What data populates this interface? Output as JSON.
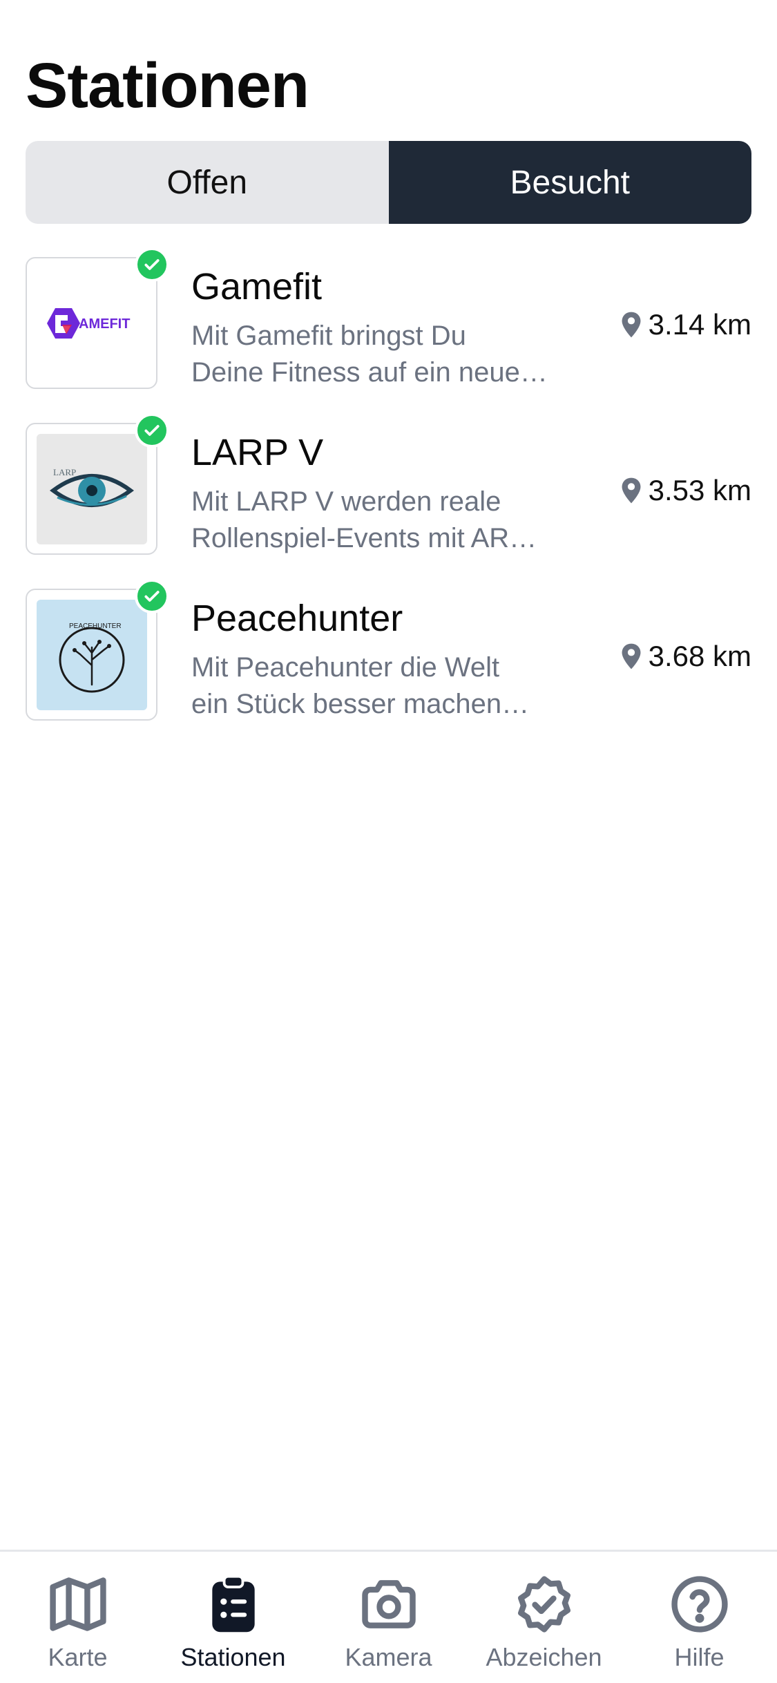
{
  "header": {
    "title": "Stationen"
  },
  "segments": {
    "open_label": "Offen",
    "visited_label": "Besucht",
    "selected": "Besucht"
  },
  "stations": [
    {
      "name": "Gamefit",
      "desc_line1": "Mit Gamefit bringst Du",
      "desc_line2": "Deine Fitness auf ein neue…",
      "distance": "3.14 km",
      "logo_text": "AMEFIT",
      "visited": true
    },
    {
      "name": "LARP V",
      "desc_line1": "Mit LARP V werden reale",
      "desc_line2": "Rollenspiel-Events mit AR…",
      "distance": "3.53 km",
      "logo_text": "LARP",
      "visited": true
    },
    {
      "name": "Peacehunter",
      "desc_line1": "Mit Peacehunter die Welt",
      "desc_line2": "ein Stück besser machen…",
      "distance": "3.68 km",
      "logo_text": "PEACEHUNTER",
      "visited": true
    }
  ],
  "tabbar": {
    "items": [
      {
        "label": "Karte",
        "icon": "map-icon"
      },
      {
        "label": "Stationen",
        "icon": "clipboard-list-icon",
        "active": true
      },
      {
        "label": "Kamera",
        "icon": "camera-icon"
      },
      {
        "label": "Abzeichen",
        "icon": "badge-check-icon"
      },
      {
        "label": "Hilfe",
        "icon": "question-circle-icon"
      }
    ]
  },
  "colors": {
    "accent_dark": "#1f2937",
    "check_green": "#22c55e",
    "muted_text": "#6b7280"
  }
}
